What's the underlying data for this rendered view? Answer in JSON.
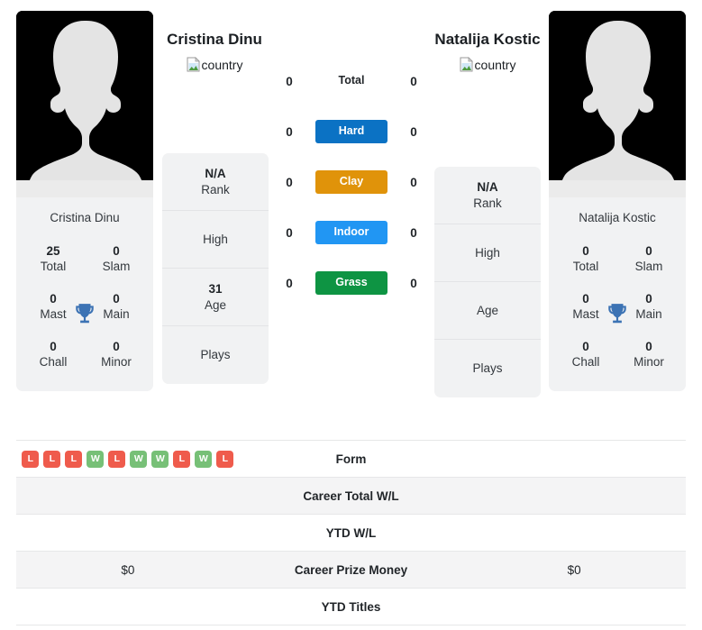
{
  "colors": {
    "hard": "#0b72c4",
    "clay": "#e0930a",
    "indoor": "#2196f3",
    "grass": "#0e9443",
    "win": "#77c077",
    "loss": "#ef5b4c",
    "trophy": "#3c73b4",
    "card_bg": "#f1f2f3",
    "row_alt": "#f4f4f5"
  },
  "left_player": {
    "name": "Cristina Dinu",
    "card_name": "Cristina Dinu",
    "country_alt": "country",
    "country_icon": "broken-image-icon",
    "photo_icon": "player-silhouette",
    "stats": [
      {
        "value": "25",
        "label": "Total"
      },
      {
        "value": "0",
        "label": "Slam"
      },
      {
        "value": "0",
        "label": "Mast"
      },
      {
        "value": "0",
        "label": "Main"
      },
      {
        "value": "0",
        "label": "Chall"
      },
      {
        "value": "0",
        "label": "Minor"
      }
    ],
    "info": [
      {
        "value": "N/A",
        "label": "Rank"
      },
      {
        "value": "",
        "label": "High"
      },
      {
        "value": "31",
        "label": "Age"
      },
      {
        "value": "",
        "label": "Plays"
      }
    ]
  },
  "right_player": {
    "name": "Natalija Kostic",
    "card_name": "Natalija Kostic",
    "country_alt": "country",
    "country_icon": "broken-image-icon",
    "photo_icon": "player-silhouette",
    "stats": [
      {
        "value": "0",
        "label": "Total"
      },
      {
        "value": "0",
        "label": "Slam"
      },
      {
        "value": "0",
        "label": "Mast"
      },
      {
        "value": "0",
        "label": "Main"
      },
      {
        "value": "0",
        "label": "Chall"
      },
      {
        "value": "0",
        "label": "Minor"
      }
    ],
    "info": [
      {
        "value": "N/A",
        "label": "Rank"
      },
      {
        "value": "",
        "label": "High"
      },
      {
        "value": "",
        "label": "Age"
      },
      {
        "value": "",
        "label": "Plays"
      }
    ]
  },
  "surfaces": [
    {
      "label": "Total",
      "left": "0",
      "right": "0",
      "style": "plain"
    },
    {
      "label": "Hard",
      "left": "0",
      "right": "0",
      "style": "hard"
    },
    {
      "label": "Clay",
      "left": "0",
      "right": "0",
      "style": "clay"
    },
    {
      "label": "Indoor",
      "left": "0",
      "right": "0",
      "style": "indoor"
    },
    {
      "label": "Grass",
      "left": "0",
      "right": "0",
      "style": "grass"
    }
  ],
  "table": {
    "rows": [
      {
        "label": "Form",
        "left": "",
        "right": "",
        "type": "form"
      },
      {
        "label": "Career Total W/L",
        "left": "",
        "right": "",
        "type": "text"
      },
      {
        "label": "YTD W/L",
        "left": "",
        "right": "",
        "type": "text"
      },
      {
        "label": "Career Prize Money",
        "left": "$0",
        "right": "$0",
        "type": "text"
      },
      {
        "label": "YTD Titles",
        "left": "",
        "right": "",
        "type": "text"
      }
    ],
    "left_form": [
      "L",
      "L",
      "L",
      "W",
      "L",
      "W",
      "W",
      "L",
      "W",
      "L"
    ],
    "right_form": []
  }
}
